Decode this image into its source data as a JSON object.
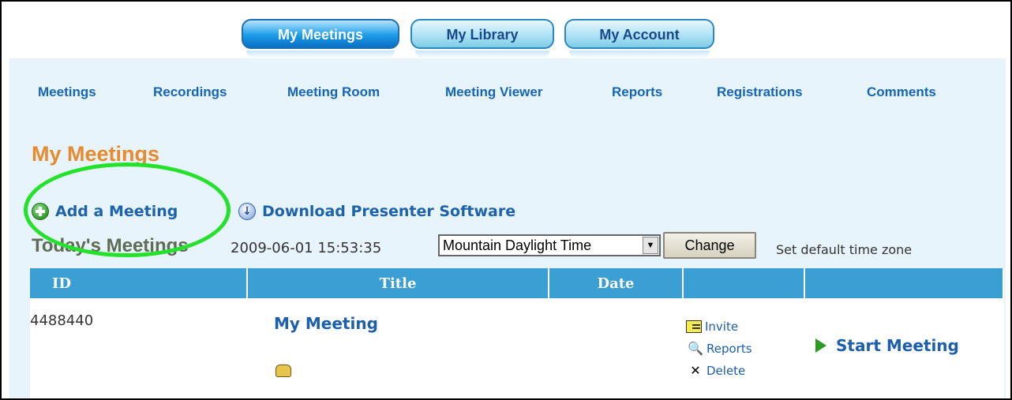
{
  "tabs": [
    {
      "label": "My Meetings",
      "active": true
    },
    {
      "label": "My Library",
      "active": false
    },
    {
      "label": "My Account",
      "active": false
    }
  ],
  "subnav": [
    "Meetings",
    "Recordings",
    "Meeting Room",
    "Meeting Viewer",
    "Reports",
    "Registrations",
    "Comments"
  ],
  "page": {
    "title": "My Meetings",
    "add_meeting": "Add a Meeting",
    "download": "Download Presenter Software"
  },
  "today": {
    "title": "Today's Meetings",
    "datetime": "2009-06-01 15:53:35",
    "timezone": "Mountain Daylight Time",
    "change_label": "Change",
    "default_tz_label": "Set default time zone"
  },
  "table": {
    "headers": [
      "ID",
      "Title",
      "Date",
      "",
      ""
    ],
    "rows": [
      {
        "id": "4488440",
        "title": "My Meeting",
        "date": "",
        "actions": [
          "Invite",
          "Reports",
          "Delete"
        ],
        "start": "Start Meeting"
      }
    ]
  },
  "colors": {
    "accent": "#3c9fd4",
    "title_orange": "#e88a2e",
    "link_blue": "#1b5fad",
    "highlight": "#22e22a"
  },
  "icons": [
    "add-icon",
    "download-icon",
    "phone-icon",
    "invite-icon",
    "reports-icon",
    "delete-icon",
    "play-icon"
  ]
}
